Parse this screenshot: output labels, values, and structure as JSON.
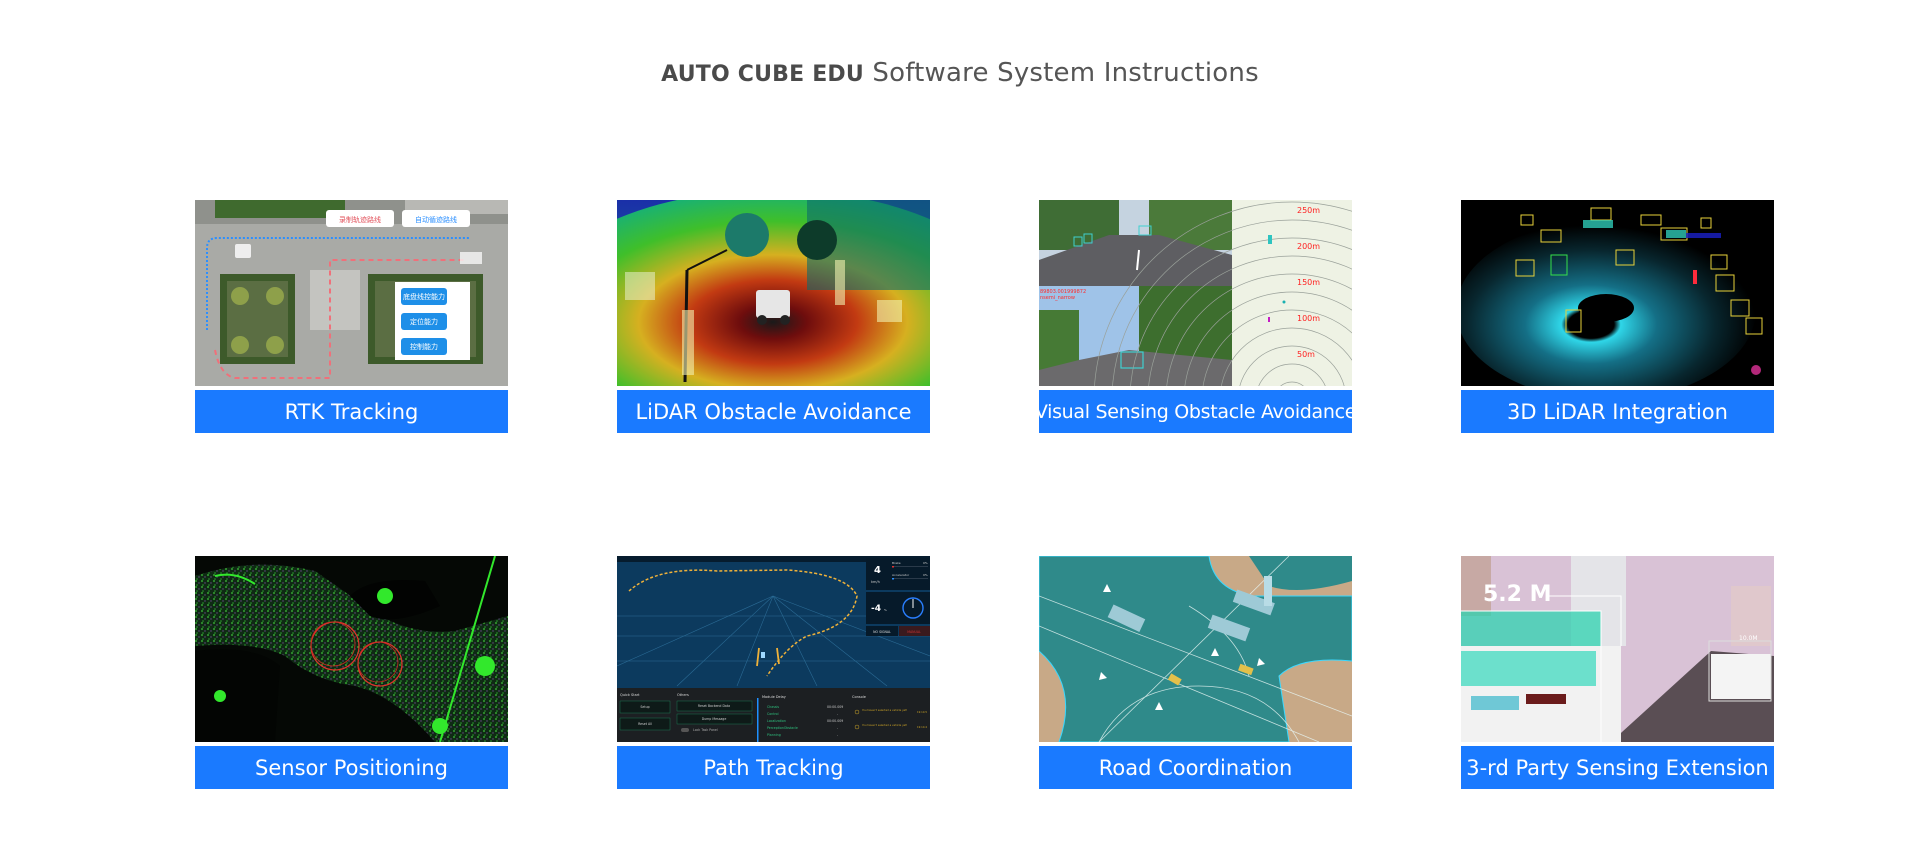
{
  "page": {
    "title_brand": "AUTO CUBE EDU",
    "title_rest": " Software System Instructions"
  },
  "theme": {
    "label_bg": "#1a7aff",
    "label_text": "#ffffff",
    "title_color": "#555555"
  },
  "cards": [
    {
      "label": "RTK Tracking",
      "image": "aerial-map-rtk",
      "legend": [
        "录制轨迹路线",
        "自动循迹路线"
      ],
      "panel_buttons": [
        "底盘线控能力",
        "定位能力",
        "控制能力"
      ]
    },
    {
      "label": "LiDAR Obstacle Avoidance",
      "image": "lidar-pointcloud-heatmap"
    },
    {
      "label": "Visual Sensing Obstacle Avoidance",
      "image": "camera-detection-radar",
      "overlay_text": [
        "89803.001999872",
        "nsemi_narrow"
      ],
      "range_labels": [
        "250m",
        "200m",
        "150m",
        "100m",
        "50m"
      ]
    },
    {
      "label": "3D LiDAR Integration",
      "image": "3d-lidar-boxes"
    },
    {
      "label": "Sensor Positioning",
      "image": "pointcloud-positioning"
    },
    {
      "label": "Path Tracking",
      "image": "path-tracking-dashboard",
      "dashboard": {
        "speed": "4",
        "speed_unit": "km/h",
        "brake_label": "Brake",
        "brake_value": "0%",
        "accel_label": "Accelerator",
        "accel_value": "0%",
        "steer": "-4",
        "steer_unit": "%",
        "signal": "NO SIGNAL",
        "mode": "MANUAL",
        "quick_start_title": "Quick Start",
        "quick_start_buttons": [
          "Setup",
          "Reset All"
        ],
        "others_title": "Others",
        "others_buttons": [
          "Reset Backend Data",
          "Dump Message"
        ],
        "lock_label": "Lock Task Panel",
        "module_delay_title": "Module Delay",
        "modules": [
          {
            "name": "Chassis",
            "value": "00:00.009"
          },
          {
            "name": "Control",
            "value": "-"
          },
          {
            "name": "Localization",
            "value": "00:00.009"
          },
          {
            "name": "PerceptionObstacle",
            "value": "-"
          },
          {
            "name": "Planning",
            "value": "-"
          }
        ],
        "console_title": "Console",
        "console_msgs": [
          {
            "text": "You haven't selected a vehicle yet!",
            "time": "19:14:5"
          },
          {
            "text": "You haven't selected a vehicle yet!",
            "time": "19:14:4"
          }
        ]
      }
    },
    {
      "label": "Road Coordination",
      "image": "intersection-aerial"
    },
    {
      "label": "3-rd Party Sensing Extension",
      "image": "road-camera-distance",
      "overlay_text": [
        "5.2 M",
        "10.0M"
      ]
    }
  ]
}
